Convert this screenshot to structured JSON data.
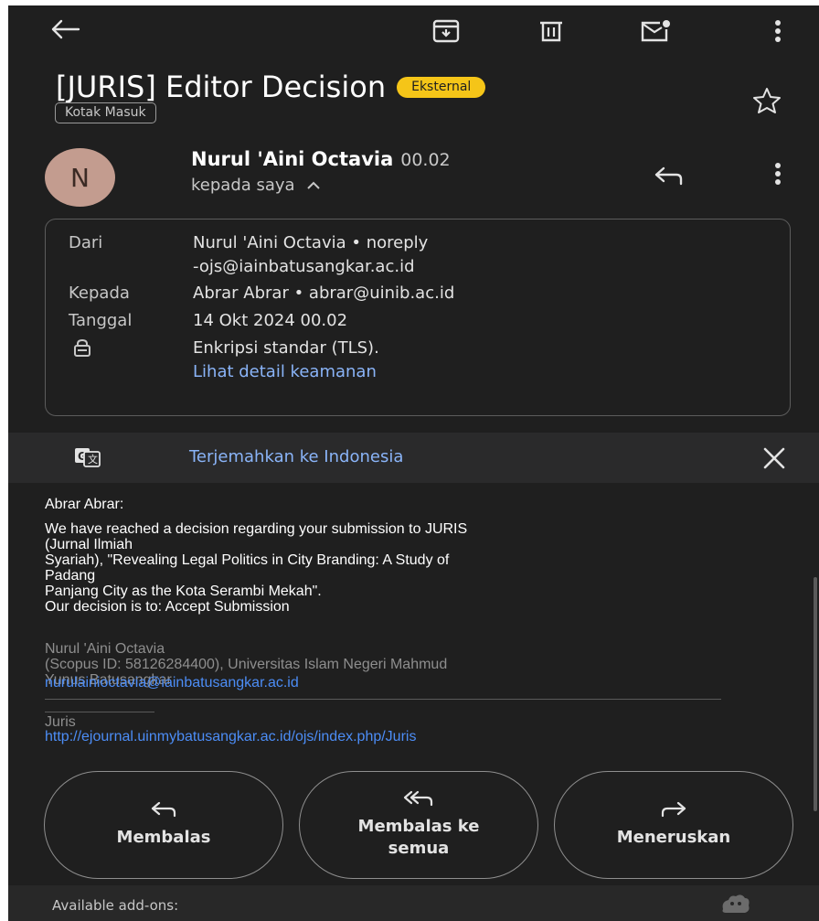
{
  "toolbar": {
    "back_icon": "arrow-left-icon",
    "archive_icon": "archive-icon",
    "delete_icon": "trash-icon",
    "mark_unread_icon": "mail-unread-icon",
    "more_icon": "more-vert-icon"
  },
  "email": {
    "subject": "[JURIS] Editor Decision",
    "badge": "Eksternal",
    "label_chip": "Kotak Masuk",
    "sender": {
      "avatar_letter": "N",
      "name": "Nurul 'Aini Octavia",
      "time": "00.02",
      "recipient_summary": "kepada saya"
    },
    "details": {
      "from_label": "Dari",
      "from_value_line1": "Nurul 'Aini Octavia • noreply",
      "from_value_line2": "-ojs@iainbatusangkar.ac.id",
      "to_label": "Kepada",
      "to_value": "Abrar Abrar • abrar@uinib.ac.id",
      "date_label": "Tanggal",
      "date_value": "14 Okt 2024 00.02",
      "security_value": "Enkripsi standar (TLS).",
      "security_link": "Lihat detail keamanan"
    }
  },
  "translate_bar": {
    "text": "Terjemahkan ke Indonesia"
  },
  "message": {
    "greeting": "Abrar Abrar:",
    "paragraph": "We have reached a decision regarding your submission to JURIS\n(Jurnal Ilmiah\nSyariah), \"Revealing Legal Politics in City Branding: A Study of\nPadang\nPanjang City as the Kota Serambi Mekah\".",
    "decision": "Our decision is to: Accept Submission",
    "signature": "Nurul 'Aini Octavia\n(Scopus ID: 58126284400), Universitas Islam Negeri Mahmud\nYunus Batusangkar",
    "signature_email": "nurulainioctavia@iainbatusangkar.ac.id",
    "journal_name": "Juris",
    "journal_url": "http://ejournal.uinmybatusangkar.ac.id/ojs/index.php/Juris"
  },
  "actions": {
    "reply": "Membalas",
    "reply_all": "Membalas ke\nsemua",
    "forward": "Meneruskan"
  },
  "footer": {
    "addons_label": "Available add-ons:"
  }
}
